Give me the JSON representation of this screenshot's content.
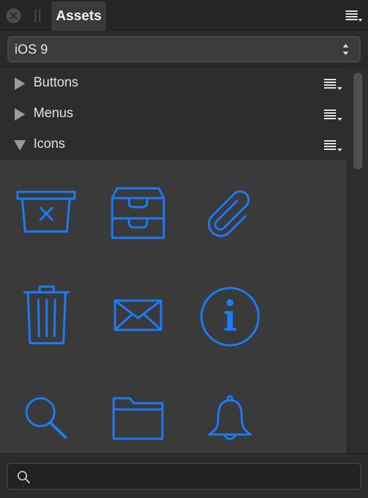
{
  "panel": {
    "tab_label": "Assets",
    "close_icon": "close-icon",
    "menu_icon": "panel-menu-icon"
  },
  "preset": {
    "selected": "iOS 9"
  },
  "categories": [
    {
      "label": "Buttons",
      "expanded": false
    },
    {
      "label": "Menus",
      "expanded": false
    },
    {
      "label": "Icons",
      "expanded": true
    }
  ],
  "assets": [
    {
      "name": "trash-bin-x-icon"
    },
    {
      "name": "inbox-tray-icon"
    },
    {
      "name": "paperclip-icon"
    },
    {
      "name": "trash-can-icon"
    },
    {
      "name": "envelope-icon"
    },
    {
      "name": "info-icon"
    },
    {
      "name": "search-icon"
    },
    {
      "name": "folder-icon"
    },
    {
      "name": "bell-icon"
    }
  ],
  "search": {
    "value": "",
    "placeholder": ""
  },
  "colors": {
    "accent": "#1a7cff",
    "panel_bg": "#2b2b2b",
    "grid_bg": "#3a3a3a"
  }
}
